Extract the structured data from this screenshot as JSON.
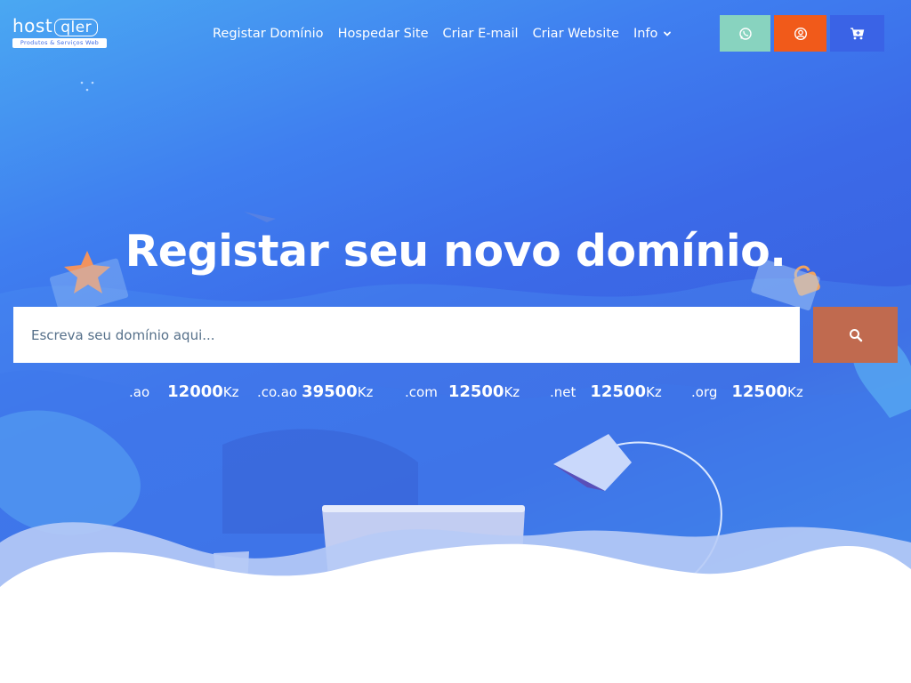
{
  "brand": {
    "logo_word": "host",
    "logo_box": "qler",
    "tagline": "Produtos & Serviços Web"
  },
  "nav": {
    "items": [
      "Registar Domínio",
      "Hospedar Site",
      "Criar E-mail",
      "Criar Website"
    ],
    "info_label": "Info"
  },
  "header_buttons": {
    "whatsapp_icon": "whatsapp-icon",
    "account_icon": "user-circle-icon",
    "cart_icon": "cart-icon"
  },
  "hero": {
    "title": "Registar seu novo domínio."
  },
  "search": {
    "placeholder": "Escreva seu domínio aqui...",
    "button_icon": "search-icon"
  },
  "prices": [
    {
      "tld": ".ao",
      "amount": "12000",
      "currency": "Kz"
    },
    {
      "tld": ".co.ao",
      "amount": "39500",
      "currency": "Kz"
    },
    {
      "tld": ".com",
      "amount": "12500",
      "currency": "Kz"
    },
    {
      "tld": ".net",
      "amount": "12500",
      "currency": "Kz"
    },
    {
      "tld": ".org",
      "amount": "12500",
      "currency": "Kz"
    }
  ],
  "colors": {
    "hero_blue": "#3b6ae8",
    "whatsapp_button": "#88d3bf",
    "account_button": "#f15a1a",
    "cart_button": "#3a63e6",
    "search_button": "#c06a4f"
  }
}
